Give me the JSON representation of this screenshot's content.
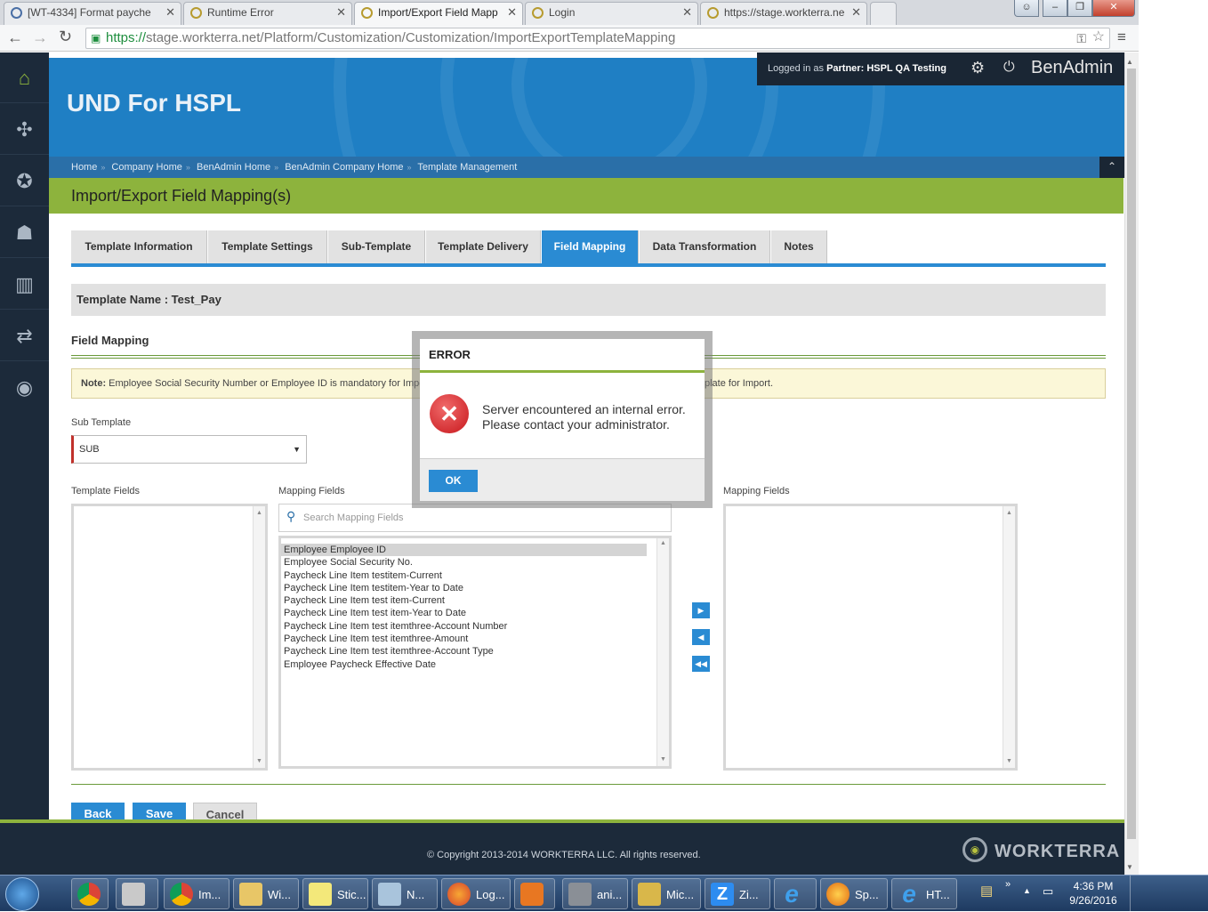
{
  "browser": {
    "tabs": [
      {
        "title": "[WT-4334] Format payche"
      },
      {
        "title": "Runtime Error"
      },
      {
        "title": "Import/Export Field Mapp"
      },
      {
        "title": "Login"
      },
      {
        "title": "https://stage.workterra.ne"
      }
    ],
    "url_scheme": "https://",
    "url_rest": "stage.workterra.net/Platform/Customization/Customization/ImportExportTemplateMapping"
  },
  "header": {
    "app_title": "UND For HSPL",
    "logged_in_prefix": "Logged in as",
    "partner_label": "Partner:",
    "partner_name": "HSPL QA Testing",
    "product": "BenAdmin"
  },
  "breadcrumbs": [
    "Home",
    "Company Home",
    "BenAdmin Home",
    "BenAdmin Company Home",
    "Template Management"
  ],
  "page_title": "Import/Export Field Mapping(s)",
  "tabs": [
    {
      "label": "Template Information"
    },
    {
      "label": "Template Settings"
    },
    {
      "label": "Sub-Template"
    },
    {
      "label": "Template Delivery"
    },
    {
      "label": "Field Mapping"
    },
    {
      "label": "Data Transformation"
    },
    {
      "label": "Notes"
    }
  ],
  "template_name": "Template Name : Test_Pay",
  "field_mapping_heading": "Field Mapping",
  "note": {
    "label": "Note:",
    "text_left": "Employee Social Security Number or Employee ID is mandatory for Impo",
    "text_right": "plate for Import."
  },
  "sub_template": {
    "label": "Sub Template",
    "value": "SUB"
  },
  "template_fields_label": "Template Fields",
  "mapping_fields_label": "Mapping Fields",
  "mapping_fields_right_label": "Mapping Fields",
  "search_placeholder": "Search Mapping Fields",
  "mapping_fields": [
    "Employee Employee ID",
    "Employee Social Security No.",
    "Paycheck Line Item testitem-Current",
    "Paycheck Line Item testitem-Year to Date",
    "Paycheck Line Item test item-Current",
    "Paycheck Line Item test item-Year to Date",
    "Paycheck Line Item test itemthree-Account Number",
    "Paycheck Line Item test itemthree-Amount",
    "Paycheck Line Item test itemthree-Account Type",
    "Employee Paycheck Effective Date"
  ],
  "buttons": {
    "back": "Back",
    "save": "Save",
    "cancel": "Cancel"
  },
  "footer": {
    "copyright": "© Copyright 2013-2014 WORKTERRA LLC. All rights reserved.",
    "brand": "WORKTERRA"
  },
  "modal": {
    "title": "ERROR",
    "line1": "Server encountered an internal error.",
    "line2": "Please contact your administrator.",
    "ok": "OK"
  },
  "taskbar": {
    "items": [
      {
        "label": "Im..."
      },
      {
        "label": "Wi..."
      },
      {
        "label": "Stic..."
      },
      {
        "label": "N..."
      },
      {
        "label": "Log..."
      },
      {
        "label": "ani..."
      },
      {
        "label": "Mic..."
      },
      {
        "label": "Zi..."
      },
      {
        "label": "Sp..."
      },
      {
        "label": "HT..."
      }
    ],
    "time": "4:36 PM",
    "date": "9/26/2016"
  }
}
